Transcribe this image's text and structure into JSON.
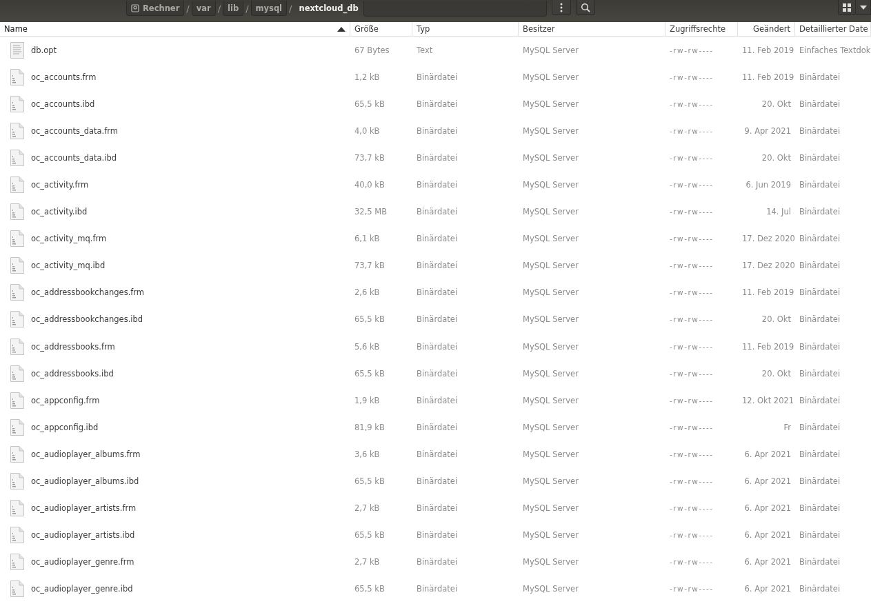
{
  "path_bar": {
    "segments": [
      {
        "label": "Rechner",
        "kind": "drive",
        "selected": false
      },
      {
        "label": "var",
        "kind": "folder",
        "selected": false
      },
      {
        "label": "lib",
        "kind": "folder",
        "selected": false
      },
      {
        "label": "mysql",
        "kind": "folder",
        "selected": false
      },
      {
        "label": "nextcloud_db",
        "kind": "folder",
        "selected": true
      }
    ],
    "separator": "/"
  },
  "table": {
    "columns": [
      {
        "label": "Name",
        "sorted": true
      },
      {
        "label": "Größe",
        "sorted": false
      },
      {
        "label": "Typ",
        "sorted": false
      },
      {
        "label": "Besitzer",
        "sorted": false
      },
      {
        "label": "Zugriffsrechte",
        "sorted": false
      },
      {
        "label": "Geändert",
        "sorted": false
      },
      {
        "label": "Detaillierter Date",
        "sorted": false
      }
    ],
    "rows": [
      {
        "kind": "text",
        "name": "db.opt",
        "size": "67 Bytes",
        "type": "Text",
        "owner": "MySQL Server",
        "permissions": "-rw-rw----",
        "modified": "11. Feb 2019",
        "detailed_type": "Einfaches Textdok"
      },
      {
        "kind": "binary",
        "name": "oc_accounts.frm",
        "size": "1,2 kB",
        "type": "Binärdatei",
        "owner": "MySQL Server",
        "permissions": "-rw-rw----",
        "modified": "11. Feb 2019",
        "detailed_type": "Binärdatei"
      },
      {
        "kind": "binary",
        "name": "oc_accounts.ibd",
        "size": "65,5 kB",
        "type": "Binärdatei",
        "owner": "MySQL Server",
        "permissions": "-rw-rw----",
        "modified": "20. Okt",
        "detailed_type": "Binärdatei"
      },
      {
        "kind": "binary",
        "name": "oc_accounts_data.frm",
        "size": "4,0 kB",
        "type": "Binärdatei",
        "owner": "MySQL Server",
        "permissions": "-rw-rw----",
        "modified": "9. Apr 2021",
        "detailed_type": "Binärdatei"
      },
      {
        "kind": "binary",
        "name": "oc_accounts_data.ibd",
        "size": "73,7 kB",
        "type": "Binärdatei",
        "owner": "MySQL Server",
        "permissions": "-rw-rw----",
        "modified": "20. Okt",
        "detailed_type": "Binärdatei"
      },
      {
        "kind": "binary",
        "name": "oc_activity.frm",
        "size": "40,0 kB",
        "type": "Binärdatei",
        "owner": "MySQL Server",
        "permissions": "-rw-rw----",
        "modified": "6. Jun 2019",
        "detailed_type": "Binärdatei"
      },
      {
        "kind": "binary",
        "name": "oc_activity.ibd",
        "size": "32,5 MB",
        "type": "Binärdatei",
        "owner": "MySQL Server",
        "permissions": "-rw-rw----",
        "modified": "14. Jul",
        "detailed_type": "Binärdatei"
      },
      {
        "kind": "binary",
        "name": "oc_activity_mq.frm",
        "size": "6,1 kB",
        "type": "Binärdatei",
        "owner": "MySQL Server",
        "permissions": "-rw-rw----",
        "modified": "17. Dez 2020",
        "detailed_type": "Binärdatei"
      },
      {
        "kind": "binary",
        "name": "oc_activity_mq.ibd",
        "size": "73,7 kB",
        "type": "Binärdatei",
        "owner": "MySQL Server",
        "permissions": "-rw-rw----",
        "modified": "17. Dez 2020",
        "detailed_type": "Binärdatei"
      },
      {
        "kind": "binary",
        "name": "oc_addressbookchanges.frm",
        "size": "2,6 kB",
        "type": "Binärdatei",
        "owner": "MySQL Server",
        "permissions": "-rw-rw----",
        "modified": "11. Feb 2019",
        "detailed_type": "Binärdatei"
      },
      {
        "kind": "binary",
        "name": "oc_addressbookchanges.ibd",
        "size": "65,5 kB",
        "type": "Binärdatei",
        "owner": "MySQL Server",
        "permissions": "-rw-rw----",
        "modified": "20. Okt",
        "detailed_type": "Binärdatei"
      },
      {
        "kind": "binary",
        "name": "oc_addressbooks.frm",
        "size": "5,6 kB",
        "type": "Binärdatei",
        "owner": "MySQL Server",
        "permissions": "-rw-rw----",
        "modified": "11. Feb 2019",
        "detailed_type": "Binärdatei"
      },
      {
        "kind": "binary",
        "name": "oc_addressbooks.ibd",
        "size": "65,5 kB",
        "type": "Binärdatei",
        "owner": "MySQL Server",
        "permissions": "-rw-rw----",
        "modified": "20. Okt",
        "detailed_type": "Binärdatei"
      },
      {
        "kind": "binary",
        "name": "oc_appconfig.frm",
        "size": "1,9 kB",
        "type": "Binärdatei",
        "owner": "MySQL Server",
        "permissions": "-rw-rw----",
        "modified": "12. Okt 2021",
        "detailed_type": "Binärdatei"
      },
      {
        "kind": "binary",
        "name": "oc_appconfig.ibd",
        "size": "81,9 kB",
        "type": "Binärdatei",
        "owner": "MySQL Server",
        "permissions": "-rw-rw----",
        "modified": "Fr",
        "detailed_type": "Binärdatei"
      },
      {
        "kind": "binary",
        "name": "oc_audioplayer_albums.frm",
        "size": "3,6 kB",
        "type": "Binärdatei",
        "owner": "MySQL Server",
        "permissions": "-rw-rw----",
        "modified": "6. Apr 2021",
        "detailed_type": "Binärdatei"
      },
      {
        "kind": "binary",
        "name": "oc_audioplayer_albums.ibd",
        "size": "65,5 kB",
        "type": "Binärdatei",
        "owner": "MySQL Server",
        "permissions": "-rw-rw----",
        "modified": "6. Apr 2021",
        "detailed_type": "Binärdatei"
      },
      {
        "kind": "binary",
        "name": "oc_audioplayer_artists.frm",
        "size": "2,7 kB",
        "type": "Binärdatei",
        "owner": "MySQL Server",
        "permissions": "-rw-rw----",
        "modified": "6. Apr 2021",
        "detailed_type": "Binärdatei"
      },
      {
        "kind": "binary",
        "name": "oc_audioplayer_artists.ibd",
        "size": "65,5 kB",
        "type": "Binärdatei",
        "owner": "MySQL Server",
        "permissions": "-rw-rw----",
        "modified": "6. Apr 2021",
        "detailed_type": "Binärdatei"
      },
      {
        "kind": "binary",
        "name": "oc_audioplayer_genre.frm",
        "size": "2,7 kB",
        "type": "Binärdatei",
        "owner": "MySQL Server",
        "permissions": "-rw-rw----",
        "modified": "6. Apr 2021",
        "detailed_type": "Binärdatei"
      },
      {
        "kind": "binary",
        "name": "oc_audioplayer_genre.ibd",
        "size": "65,5 kB",
        "type": "Binärdatei",
        "owner": "MySQL Server",
        "permissions": "-rw-rw----",
        "modified": "6. Apr 2021",
        "detailed_type": "Binärdatei"
      }
    ]
  }
}
